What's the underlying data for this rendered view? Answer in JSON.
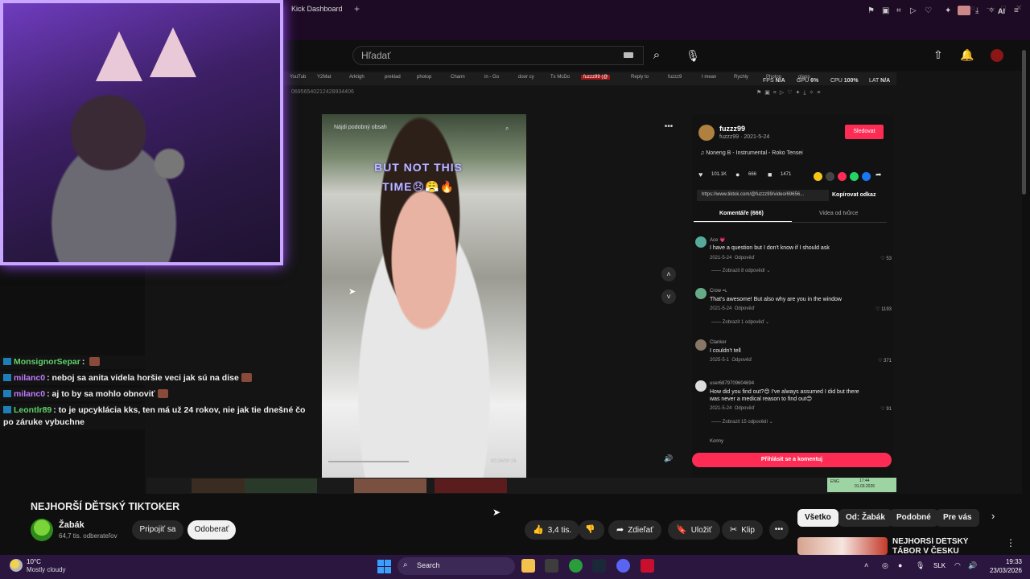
{
  "browser": {
    "tab_title": "Kick Dashboard",
    "ai_label": "AI"
  },
  "youtube": {
    "search_placeholder": "Hľadať",
    "video_title": "NEJHORŠÍ DĚTSKÝ TIKTOKER",
    "channel_name": "Žabák",
    "channel_subs": "64,7 tis. odberateľov",
    "join_label": "Pripojiť sa",
    "subscribed_label": "Odoberať",
    "like_count": "3,4 tis.",
    "share_label": "Zdieľať",
    "save_label": "Uložiť",
    "clip_label": "Klip",
    "chips": [
      "Všetko",
      "Od: Žabák",
      "Podobné",
      "Pre vás"
    ],
    "related_title": "NEJHORŠÍ DĚTSKÝ TÁBOR V ČESKU"
  },
  "embedded": {
    "bookmarks": [
      "YouTub",
      "Y2Mat",
      "Arktigh",
      "preklad",
      "photop",
      "Chann",
      "in - Go",
      "door cy",
      "Tx McDo",
      "fuzzz99 (@",
      "Reply to",
      "fuzzz9",
      "I mean",
      "Rychly",
      "Photop",
      "glapp"
    ],
    "stats": {
      "fps_label": "FPS",
      "fps_value": "N/A",
      "gpu_label": "GPU",
      "gpu_value": "6%",
      "cpu_label": "CPU",
      "cpu_value": "100%",
      "lat_label": "LAT",
      "lat_value": "N/A"
    },
    "url": "06956540212428934406",
    "video_search": "Nájdi podobný obsah",
    "video_caption_1": "BUT NOT THIS",
    "video_caption_2": "TIME😞😤🔥",
    "video_time": "00:26/00:26",
    "tiktok": {
      "username": "fuzzz99",
      "user_date": "fuzzz99 · 2021-5-24",
      "follow_label": "Sledovat",
      "music": "♫ Noneng B - Instrumental - Roko Tensei",
      "likes": "101.1K",
      "comments_count": "666",
      "saves": "1471",
      "link": "https://www.tiktok.com/@fuzzz99/video/69656...",
      "copy_label": "Kopírovat odkaz",
      "tab_comments": "Komentáře (666)",
      "tab_videos": "Videa od tvůrce",
      "comments": [
        {
          "name": "Ace 💗",
          "text": "I have a question but I don't know if I should ask",
          "date": "2021-5-24",
          "reply": "Odpověď",
          "likes": "53",
          "replies": "Zobrazit 8 odpovědí ⌄",
          "color": "#5a9"
        },
        {
          "name": "Crow =ʟ",
          "text": "That's awesome! But also why are you in the window",
          "date": "2021-5-24",
          "reply": "Odpověď",
          "likes": "1193",
          "replies": "Zobrazit 1 odpověď ⌄",
          "color": "#6a8"
        },
        {
          "name": "Clanker",
          "text": "I couldn't tell",
          "date": "2025-5-1",
          "reply": "Odpověď",
          "likes": "371",
          "replies": "",
          "color": "#876"
        },
        {
          "name": "user6879709604694",
          "text": "How did you find out?😊 I've always assumed I did but there was never a medical reason to find out😊",
          "date": "2021-5-24",
          "reply": "Odpověď",
          "likes": "91",
          "replies": "Zobrazit 15 odpovědí ⌄",
          "color": "#ddd"
        }
      ],
      "partial_name": "Konny",
      "login_label": "Přihlásit se a komentuj"
    },
    "tray_lang": "ENG",
    "tray_time": "17:44",
    "tray_date": "01.03.2026"
  },
  "chat": [
    {
      "user": "MonsignorSepar",
      "color": "#5fd16a",
      "message": ""
    },
    {
      "user": "milanc0",
      "color": "#c07bff",
      "message": "neboj sa anita videla horšie veci jak sú na dise"
    },
    {
      "user": "milanc0",
      "color": "#c07bff",
      "message": "aj to by sa mohlo obnoviť"
    },
    {
      "user": "Leontlr89",
      "color": "#5fd16a",
      "message": "to je upcyklácia kks, ten má už 24 rokov, nie jak tie dnešné čo po záruke vybuchne"
    }
  ],
  "taskbar": {
    "temp": "10°C",
    "weather": "Mostly cloudy",
    "search_label": "Search",
    "lang": "SLK",
    "time": "19:33",
    "date": "23/03/2026"
  },
  "colors": {
    "accent_tiktok": "#fe2c55",
    "webcam_border": "#c9a6ff",
    "taskbar_bg": "#2b1640"
  }
}
